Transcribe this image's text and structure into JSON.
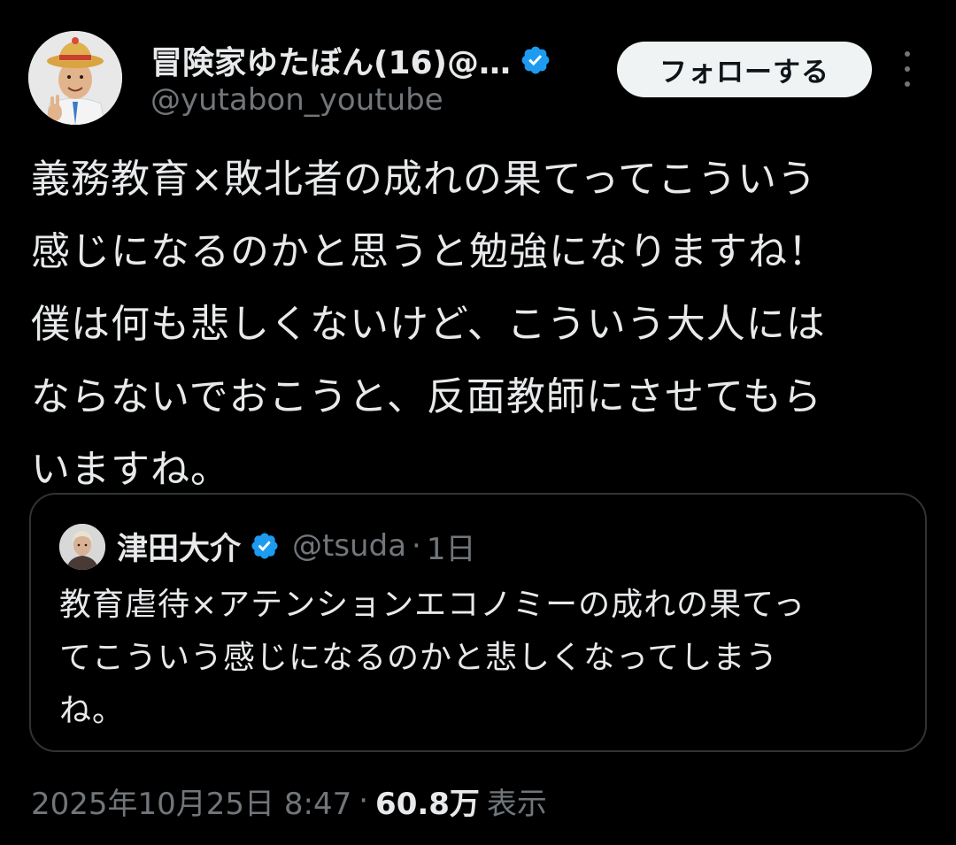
{
  "author": {
    "display_name": "冒険家ゆたぼん(16)@…",
    "handle": "@yutabon_youtube",
    "verified": true,
    "avatar_icon": "user-avatar"
  },
  "follow_button": {
    "label": "フォローする"
  },
  "more_menu": {
    "icon": "more-vertical-icon"
  },
  "tweet": {
    "text": "義務教育×敗北者の成れの果てってこういう\n感じになるのかと思うと勉強になりますね！\n僕は何も悲しくないけど、こういう大人には\nならないでおこうと、反面教師にさせてもら\nいますね。"
  },
  "quote": {
    "display_name": "津田大介",
    "handle": "@tsuda",
    "dot": "·",
    "time": "1日",
    "verified": true,
    "text": "教育虐待×アテンションエコノミーの成れの果てっ\nてこういう感じになるのかと悲しくなってしまう\nね。"
  },
  "meta": {
    "timestamp": "2025年10月25日 8:47",
    "dot": "·",
    "views": "60.8万",
    "views_label": "表示"
  },
  "colors": {
    "background": "#000000",
    "text_primary": "#e7e9ea",
    "text_secondary": "#71767b",
    "verified_blue": "#1d9bf0",
    "border": "#2f3336",
    "follow_bg": "#eff3f4"
  }
}
